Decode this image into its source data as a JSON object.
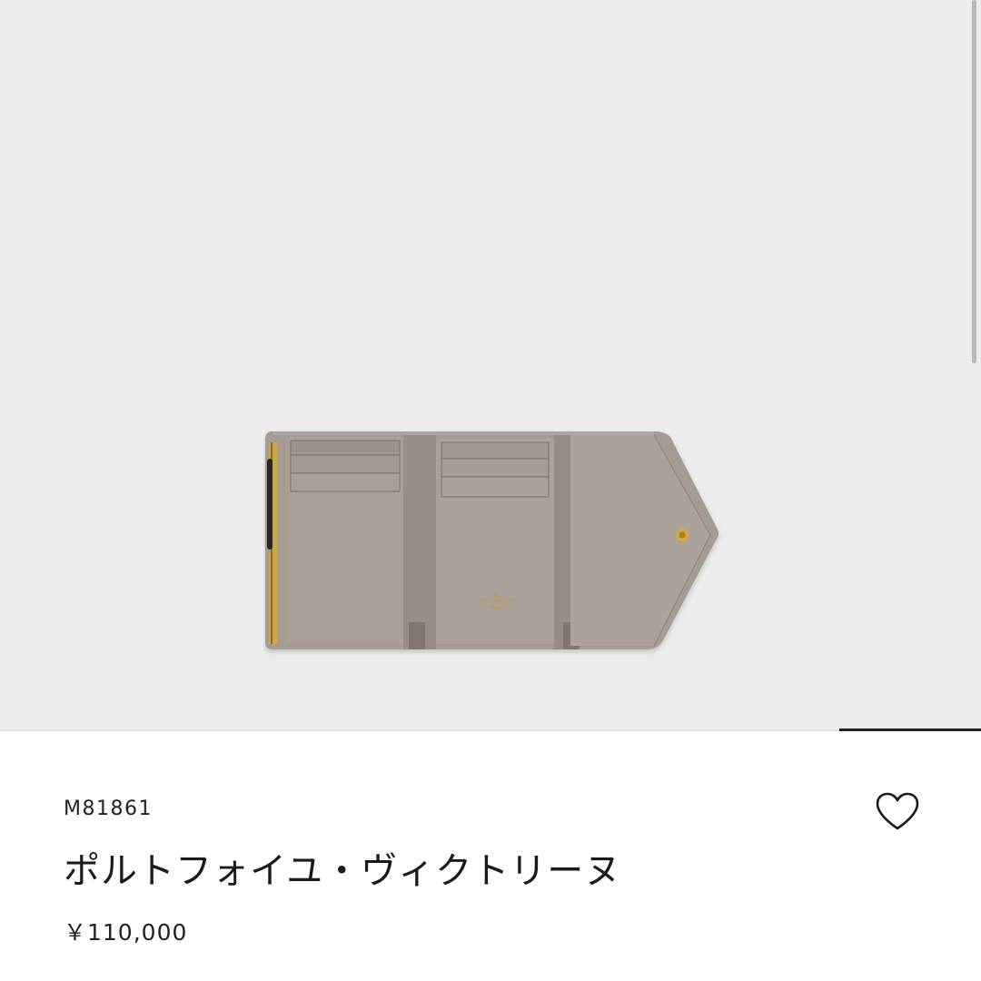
{
  "product": {
    "sku": "M81861",
    "name": "ポルトフォイユ・ヴィクトリーヌ",
    "price": "￥110,000",
    "image_logo_text": [
      "LOUIS VUITTON",
      "PARIS"
    ]
  },
  "icons": {
    "wishlist": "heart-outline-icon"
  },
  "colors": {
    "hero_background": "#ececec",
    "leather": "#a9a198",
    "hardware": "#d3a937",
    "text": "#1a1a1a"
  }
}
